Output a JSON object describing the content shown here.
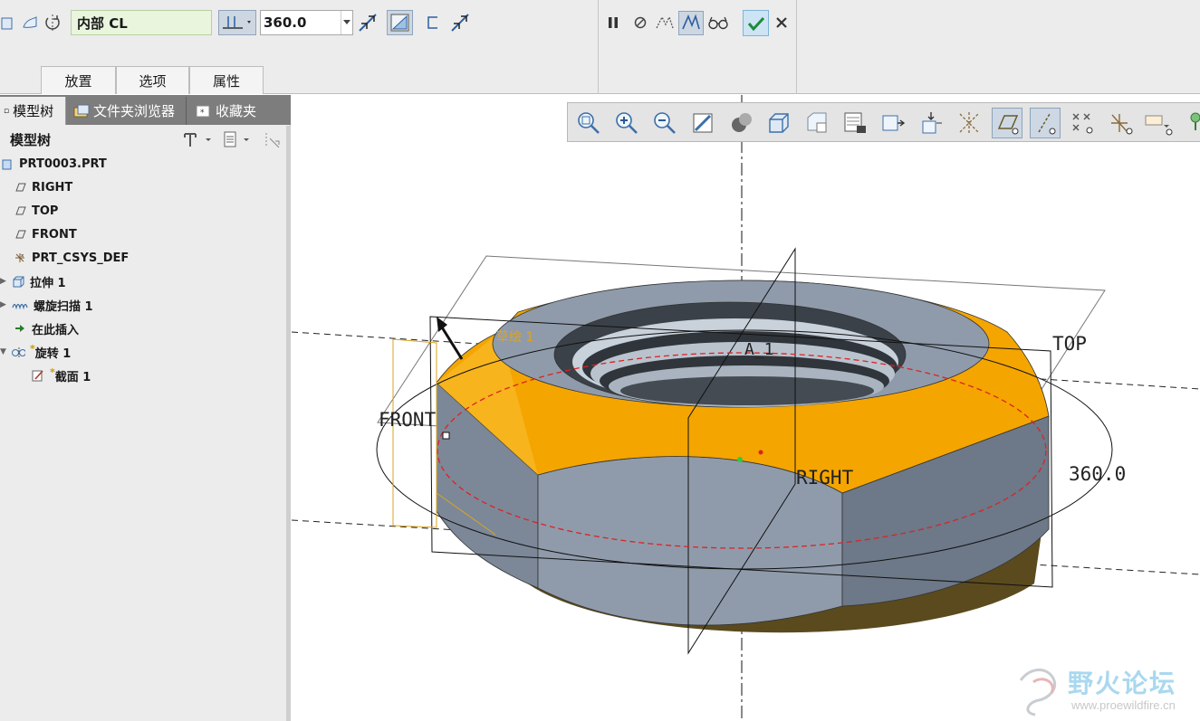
{
  "dashboard": {
    "axis_reference": "内部 CL",
    "angle_value": "360.0",
    "tabs": [
      {
        "label": "放置"
      },
      {
        "label": "选项"
      },
      {
        "label": "属性"
      }
    ],
    "icons": [
      "solid-icon",
      "surface-icon",
      "revolve-icon",
      "axis-type-icon",
      "flip-direction-icon",
      "remove-material-icon",
      "thicken-icon",
      "flip-material-icon",
      "pause-icon",
      "no-preview-icon",
      "attach-preview-icon",
      "geometry-preview-icon",
      "verify-glasses-icon",
      "ok-check-icon",
      "cancel-x-icon"
    ]
  },
  "left_pane": {
    "tabs": [
      {
        "label": "模型树"
      },
      {
        "label": "文件夹浏览器"
      },
      {
        "label": "收藏夹"
      }
    ],
    "header": "模型树",
    "tree": [
      {
        "label": "PRT0003.PRT",
        "icon": "part-icon",
        "expand": false,
        "new": false
      },
      {
        "label": "RIGHT",
        "icon": "datum-plane-icon",
        "expand": false,
        "new": false
      },
      {
        "label": "TOP",
        "icon": "datum-plane-icon",
        "expand": false,
        "new": false
      },
      {
        "label": "FRONT",
        "icon": "datum-plane-icon",
        "expand": false,
        "new": false
      },
      {
        "label": "PRT_CSYS_DEF",
        "icon": "csys-icon",
        "expand": false,
        "new": false
      },
      {
        "label": "拉伸 1",
        "icon": "extrude-icon",
        "expand": true,
        "new": false
      },
      {
        "label": "螺旋扫描 1",
        "icon": "helical-sweep-icon",
        "expand": true,
        "new": false
      },
      {
        "label": "在此插入",
        "icon": "insert-here-icon",
        "expand": false,
        "new": false
      },
      {
        "label": "旋转 1",
        "icon": "revolve-icon",
        "expand": true,
        "new": true
      },
      {
        "label": "截面 1",
        "icon": "sketch-icon",
        "expand": false,
        "new": true
      }
    ]
  },
  "graphics": {
    "labels": {
      "front": "FRONT",
      "top": "TOP",
      "right": "RIGHT",
      "angle": "360.0",
      "axis": "A_1",
      "sketch": "草绘 1"
    },
    "colors": {
      "body": "#8a96a6",
      "top_face": "#8f9bab",
      "highlight": "#f4a500",
      "underside": "#5a4a1e",
      "preview_curve": "#dd2222"
    },
    "view_toolbar_icons": [
      "refit-icon",
      "zoom-in-icon",
      "zoom-out-icon",
      "repaint-icon",
      "display-style-icon",
      "saved-views-icon",
      "view-manager-icon",
      "section-icon",
      "perspective-icon",
      "annotation-display-icon",
      "datum-display-icon",
      "plane-display-icon",
      "axis-display-icon",
      "point-display-icon",
      "csys-display-icon",
      "spin-center-icon",
      "more-icon"
    ]
  },
  "watermark": {
    "title": "野火论坛",
    "url": "www.proewildfire.cn"
  }
}
